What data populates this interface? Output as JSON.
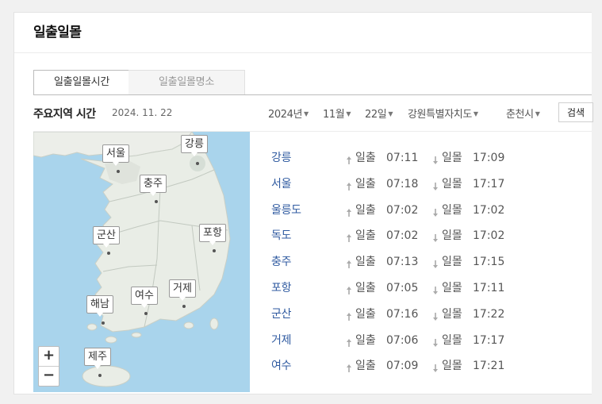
{
  "page_title": "일출일몰",
  "tabs": [
    {
      "label": "일출일몰시간",
      "active": true
    },
    {
      "label": "일출일몰명소",
      "active": false
    }
  ],
  "section": {
    "title": "주요지역 시간",
    "date": "2024. 11. 22"
  },
  "filters": {
    "year": "2024년",
    "month": "11월",
    "day": "22일",
    "province": "강원특별자치도",
    "city": "춘천시",
    "search_label": "검색"
  },
  "map": {
    "zoom_in": "+",
    "zoom_out": "−",
    "labels": {
      "gangneung": "강릉",
      "seoul": "서울",
      "chungju": "충주",
      "pohang": "포항",
      "gunsan": "군산",
      "geoje": "거제",
      "yeosu": "여수",
      "haenam": "해남",
      "jeju": "제주"
    }
  },
  "sunrise_label": "일출",
  "sunset_label": "일몰",
  "rows": [
    {
      "city": "강릉",
      "sunrise": "07:11",
      "sunset": "17:09"
    },
    {
      "city": "서울",
      "sunrise": "07:18",
      "sunset": "17:17"
    },
    {
      "city": "울릉도",
      "sunrise": "07:02",
      "sunset": "17:02"
    },
    {
      "city": "독도",
      "sunrise": "07:02",
      "sunset": "17:02"
    },
    {
      "city": "충주",
      "sunrise": "07:13",
      "sunset": "17:15"
    },
    {
      "city": "포항",
      "sunrise": "07:05",
      "sunset": "17:11"
    },
    {
      "city": "군산",
      "sunrise": "07:16",
      "sunset": "17:22"
    },
    {
      "city": "거제",
      "sunrise": "07:06",
      "sunset": "17:17"
    },
    {
      "city": "여수",
      "sunrise": "07:09",
      "sunset": "17:21"
    }
  ],
  "colors": {
    "link": "#2f5aa0",
    "sea": "#a9d4ec",
    "land": "#e9ede6"
  }
}
